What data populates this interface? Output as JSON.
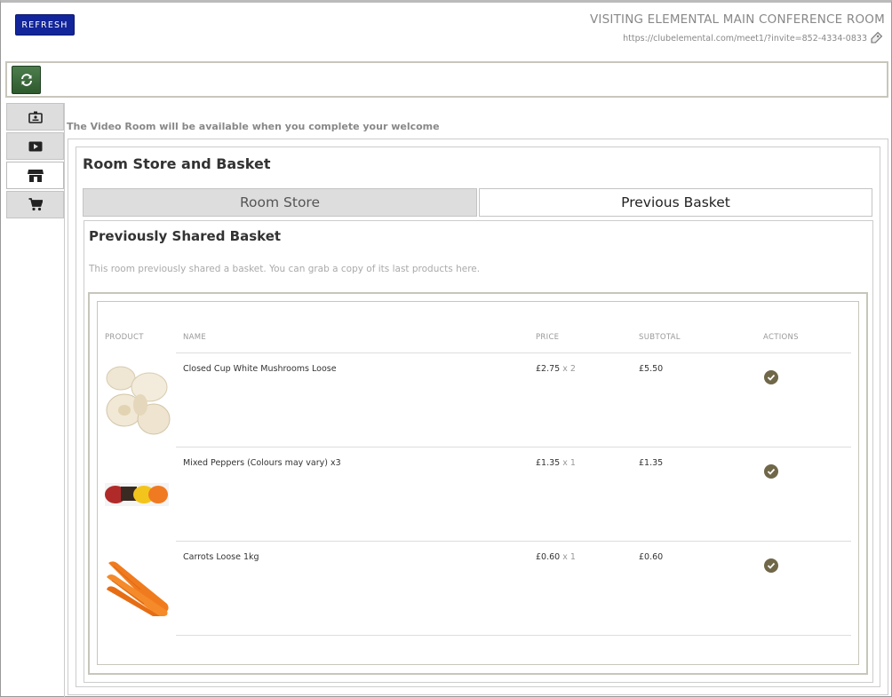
{
  "header": {
    "refresh_label": "REFRESH",
    "room_title": "VISITING ELEMENTAL MAIN CONFERENCE ROOM",
    "room_url": "https://clubelemental.com/meet1/?invite=852-4334-0833"
  },
  "toolbar": {
    "sync_icon": "sync-icon"
  },
  "sidebar": {
    "items": [
      {
        "icon": "id-badge-icon",
        "active": false
      },
      {
        "icon": "video-play-icon",
        "active": false
      },
      {
        "icon": "store-icon",
        "active": true
      },
      {
        "icon": "cart-icon",
        "active": false
      }
    ]
  },
  "notice": "The Video Room will be available when you complete your welcome",
  "store": {
    "heading": "Room Store and Basket",
    "tabs": {
      "store": "Room Store",
      "previous": "Previous Basket"
    },
    "basket": {
      "heading": "Previously Shared Basket",
      "description": "This room previously shared a basket. You can grab a copy of its last products here.",
      "columns": {
        "product": "PRODUCT",
        "name": "NAME",
        "price": "PRICE",
        "subtotal": "SUBTOTAL",
        "actions": "ACTIONS"
      },
      "rows": [
        {
          "name": "Closed Cup White Mushrooms Loose",
          "price": "£2.75",
          "qty": "x 2",
          "subtotal": "£5.50",
          "image": "mushrooms"
        },
        {
          "name": "Mixed Peppers (Colours may vary) x3",
          "price": "£1.35",
          "qty": "x 1",
          "subtotal": "£1.35",
          "image": "peppers"
        },
        {
          "name": "Carrots Loose 1kg",
          "price": "£0.60",
          "qty": "x 1",
          "subtotal": "£0.60",
          "image": "carrots"
        }
      ]
    }
  },
  "colors": {
    "refresh_bg": "#13259a",
    "sync_bg": "#2e5a2e",
    "action_check": "#6f6748"
  }
}
